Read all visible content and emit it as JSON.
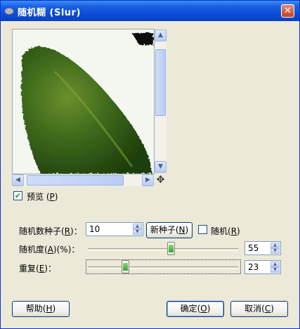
{
  "window": {
    "title": "随机糊 (Slur)"
  },
  "preview": {
    "checkbox_label": "预览",
    "mnemonic": "P",
    "checked": true
  },
  "random_seed": {
    "label": "随机数种子",
    "mnemonic": "R",
    "value": "10",
    "new_seed_label": "新种子",
    "new_seed_mnemonic": "N",
    "randomize_label": "随机",
    "randomize_mnemonic": "R",
    "randomize_checked": false
  },
  "randomization": {
    "label": "随机度",
    "mnemonic1": "A",
    "unit": "(%)",
    "value": "55",
    "fraction": 0.55
  },
  "repeat": {
    "label": "重复",
    "mnemonic": "E",
    "value": "23",
    "fraction": 0.23
  },
  "buttons": {
    "help": "帮助",
    "help_key": "H",
    "ok": "确定",
    "ok_key": "O",
    "cancel": "取消",
    "cancel_key": "C"
  },
  "colors": {
    "titlebar": "#0a4bd4",
    "dialog_bg": "#ece9d8",
    "leaf": "#3f6b1c"
  },
  "icons": {
    "title": "gimp-icon",
    "close": "close-icon",
    "nav": "navigate-icon"
  }
}
